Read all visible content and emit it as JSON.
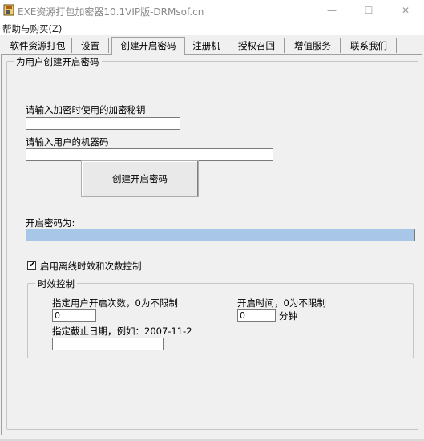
{
  "window": {
    "title": "EXE资源打包加密器10.1VIP版-DRMsof.cn",
    "minimize_glyph": "—",
    "maximize_glyph": "☐",
    "close_glyph": "✕"
  },
  "menu": {
    "help_buy": "帮助与购买(Z)"
  },
  "tabs": [
    {
      "label": "软件资源打包"
    },
    {
      "label": "设置"
    },
    {
      "label": "创建开启密码"
    },
    {
      "label": "注册机"
    },
    {
      "label": "授权召回"
    },
    {
      "label": "增值服务"
    },
    {
      "label": "联系我们"
    }
  ],
  "active_tab": "创建开启密码",
  "group_create": {
    "legend": "为用户创建开启密码"
  },
  "fields": {
    "secret_key_label": "请输入加密时使用的加密秘钥",
    "secret_key_value": "",
    "machine_code_label": "请输入用户的机器码",
    "machine_code_value": ""
  },
  "create_button": "创建开启密码",
  "result": {
    "label": "开启密码为:",
    "value": ""
  },
  "offline_control": {
    "checkbox_label": "启用离线时效和次数控制",
    "checked": true
  },
  "group_time": {
    "legend": "时效控制",
    "open_count_label": "指定用户开启次数，0为不限制",
    "open_count_value": "0",
    "open_time_label": "开启时间，0为不限制",
    "open_time_value": "0",
    "minutes_label": "分钟",
    "expiry_label": "指定截止日期，例如：2007-11-2",
    "expiry_value": ""
  }
}
